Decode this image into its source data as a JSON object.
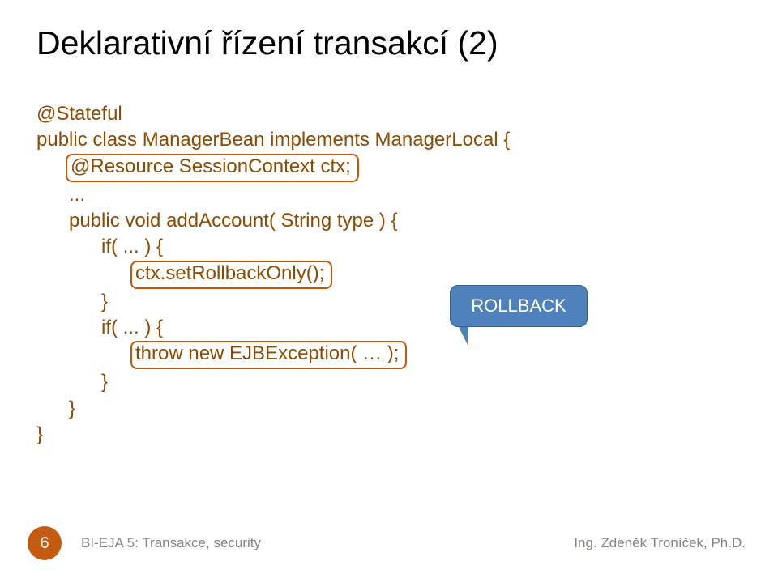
{
  "title": "Deklarativní řízení transakcí (2)",
  "code": {
    "l1": "@Stateful",
    "l2": "public class ManagerBean implements ManagerLocal {",
    "l3": "@Resource SessionContext ctx;",
    "l4": "...",
    "l5": "public void addAccount( String type ) {",
    "l6": "if( ... ) {",
    "l7": "ctx.setRollbackOnly();",
    "l8": "}",
    "l9": "if( ... ) {",
    "l10": "throw new EJBException( … );",
    "l11": "}",
    "l12": "}",
    "l13": "}"
  },
  "callout": "ROLLBACK",
  "footer": {
    "page": "6",
    "left": "BI-EJA 5: Transakce, security",
    "right": "Ing. Zdeněk Troníček, Ph.D."
  }
}
